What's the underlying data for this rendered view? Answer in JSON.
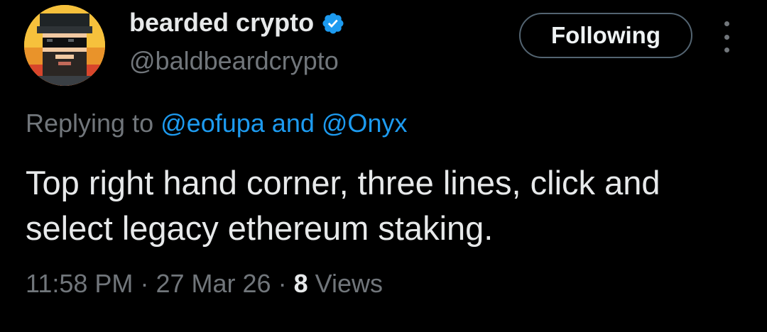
{
  "author": {
    "display_name": "bearded crypto",
    "handle": "@baldbeardcrypto",
    "verified_icon": "verified-badge-icon",
    "verified_color": "#1d9bf0"
  },
  "follow_button": {
    "label": "Following"
  },
  "more_menu_icon": "more-vertical-icon",
  "reply_context": {
    "prefix": "Replying to",
    "mention_1": "@eofupa",
    "conjunction": "and",
    "mention_2": "@Onyx"
  },
  "tweet": {
    "text": "Top right hand corner, three lines, click and select legacy ethereum staking."
  },
  "meta": {
    "time": "11:58 PM",
    "separator": "·",
    "date": "27 Mar 26",
    "views_count": "8",
    "views_label": "Views"
  },
  "colors": {
    "background": "#000000",
    "primary_text": "#e7e9ea",
    "secondary_text": "#71767b",
    "link": "#1d9bf0",
    "button_border": "#536471"
  }
}
